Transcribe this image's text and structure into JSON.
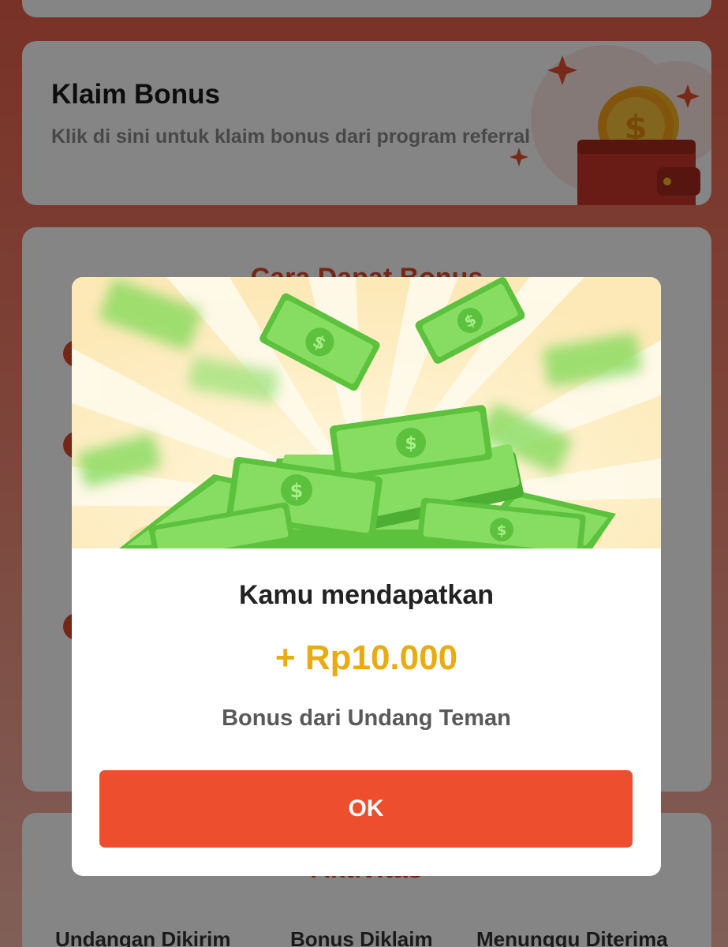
{
  "claim_card": {
    "title": "Klaim Bonus",
    "subtitle": "Klik di sini untuk klaim bonus dari program referral",
    "icon": "wallet-coin-icon"
  },
  "steps_card": {
    "title": "Cara Dapat Bonus"
  },
  "stats_card": {
    "title": "Aktivitas",
    "labels": [
      "Undangan Dikirim",
      "Bonus Diklaim",
      "Menunggu Diterima"
    ]
  },
  "modal": {
    "heading": "Kamu mendapatkan",
    "amount": "+ Rp10.000",
    "description": "Bonus dari Undang Teman",
    "ok_label": "OK",
    "hero_icon": "money-pile-icon"
  },
  "colors": {
    "accent": "#ed4e2e",
    "amount": "#e8ac12",
    "money_green": "#7ed957"
  }
}
